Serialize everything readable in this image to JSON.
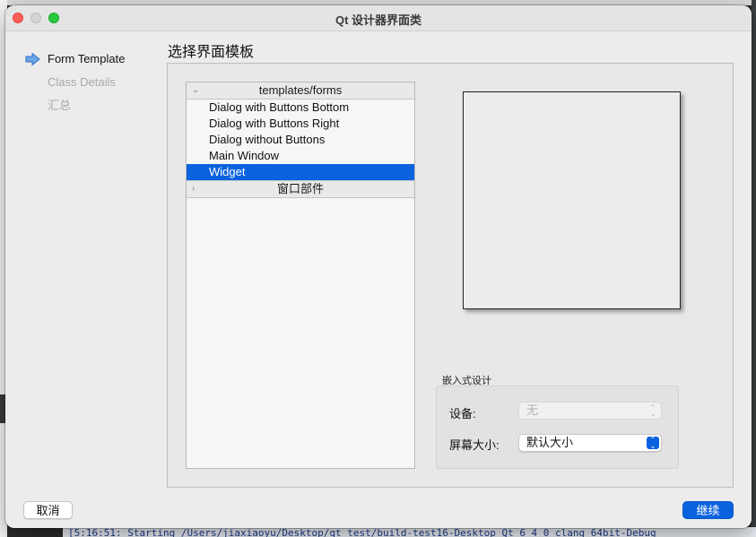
{
  "window": {
    "title": "Qt 设计器界面类"
  },
  "wizard_steps": [
    {
      "label": "Form Template",
      "active": true
    },
    {
      "label": "Class Details",
      "active": false
    },
    {
      "label": "汇总",
      "active": false
    }
  ],
  "page_title": "选择界面模板",
  "templates": {
    "group_forms": "templates/forms",
    "items": [
      "Dialog with Buttons Bottom",
      "Dialog with Buttons Right",
      "Dialog without Buttons",
      "Main Window",
      "Widget"
    ],
    "selected": "Widget",
    "group_widgets": "窗口部件"
  },
  "embedded": {
    "section_label": "嵌入式设计",
    "device_label": "设备:",
    "device_value": "无",
    "screen_size_label": "屏幕大小:",
    "screen_size_value": "默认大小"
  },
  "buttons": {
    "cancel": "取消",
    "next": "继续"
  },
  "colors": {
    "accent": "#0a62de",
    "close": "#fe5f57",
    "maximize": "#28c840"
  },
  "background": {
    "console_line": "[5:16:51: Starting /Users/jiaxiaoyu/Desktop/qt_test/build-test16-Desktop_Qt_6_4_0_clang_64bit-Debug"
  }
}
